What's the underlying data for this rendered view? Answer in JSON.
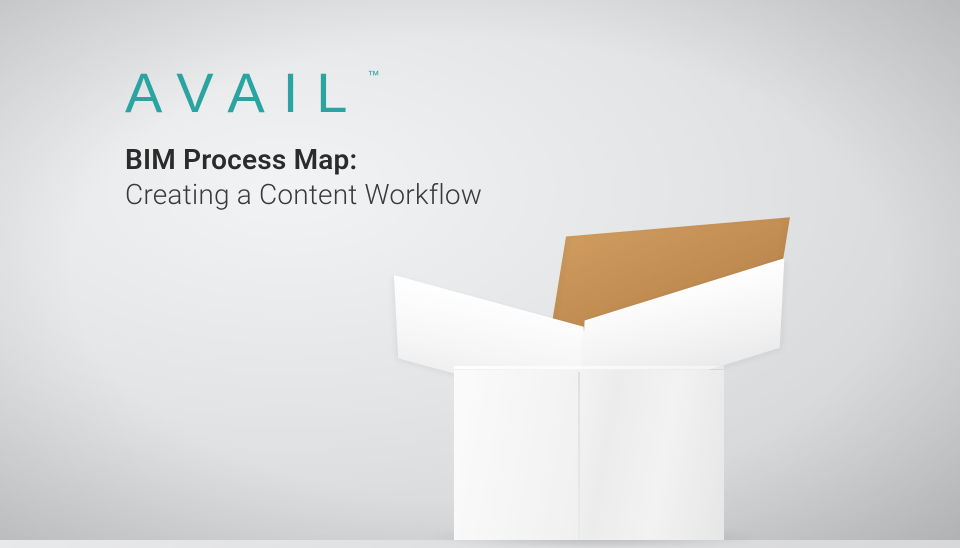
{
  "brand": {
    "logo_text": "AVAIL",
    "trademark": "™",
    "logo_color": "#2aa4a0"
  },
  "headline": {
    "line1": "BIM Process Map:",
    "line2": "Creating a Content Workflow"
  }
}
